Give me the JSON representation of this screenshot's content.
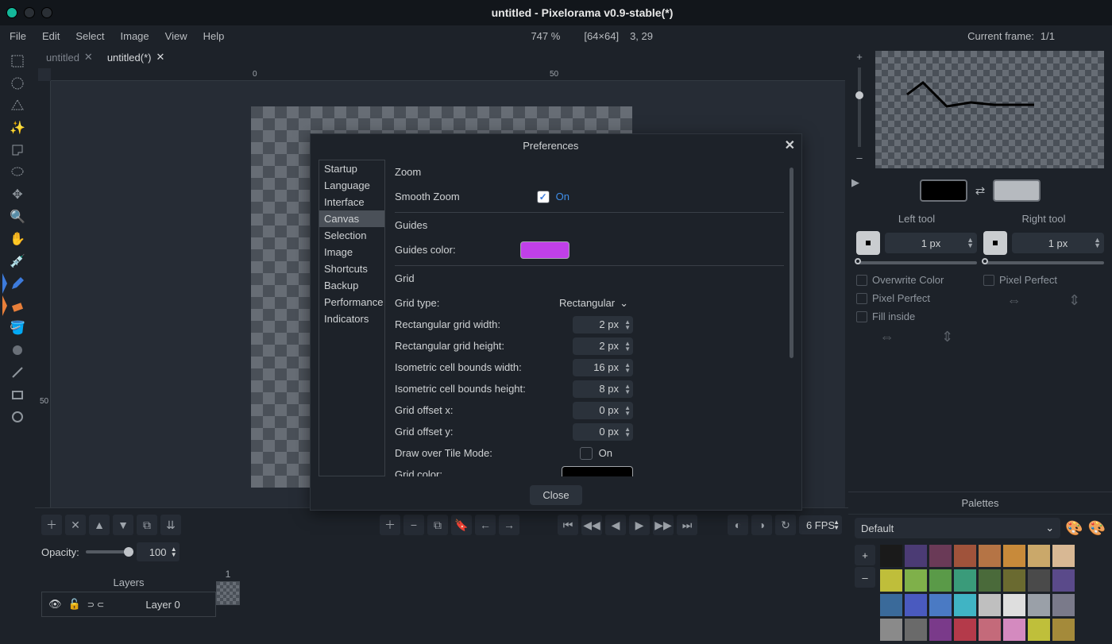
{
  "window": {
    "title": "untitled - Pixelorama v0.9-stable(*)"
  },
  "menu": {
    "items": [
      "File",
      "Edit",
      "Select",
      "Image",
      "View",
      "Help"
    ],
    "zoom": "747 %",
    "dims": "[64×64]",
    "cursor": "3, 29",
    "current_frame_lbl": "Current frame:",
    "current_frame_val": "1/1"
  },
  "tabs": [
    {
      "label": "untitled",
      "active": false
    },
    {
      "label": "untitled(*)",
      "active": true
    }
  ],
  "ruler": {
    "h0": "0",
    "h50": "50",
    "v50": "50"
  },
  "preview": {
    "plus": "+",
    "minus": "–"
  },
  "tools": {
    "left_title": "Left tool",
    "right_title": "Right tool",
    "left_px": "1 px",
    "right_px": "1 px",
    "overwrite": "Overwrite Color",
    "pixel_perfect": "Pixel Perfect",
    "fill_inside": "Fill inside"
  },
  "palettes": {
    "title": "Palettes",
    "default": "Default",
    "plus": "+",
    "minus": "–",
    "colors": [
      "#1a1a1a",
      "#4b3b74",
      "#6a3a57",
      "#a0533b",
      "#b57445",
      "#c88a3a",
      "#caa86a",
      "#d8b894",
      "#bfbe3a",
      "#7fb04a",
      "#5a9a48",
      "#3a9b7a",
      "#4a6a3a",
      "#6a6a30",
      "#4a4a4a",
      "#5a4a8a",
      "#3a6a9a",
      "#4a5abf",
      "#4a7ac4",
      "#40b4c4",
      "#bfbfbf",
      "#dedede",
      "#9aa0a8",
      "#7a7a8a",
      "#8a8a8a",
      "#6a6a6a",
      "#7a3a8a",
      "#b43a4a",
      "#c46a7a",
      "#d48abf",
      "#bfbf3a",
      "#a48a3a"
    ]
  },
  "timeline": {
    "opacity_lbl": "Opacity:",
    "opacity_val": "100",
    "fps": "6 FPS",
    "layers_lbl": "Layers",
    "layer0": "Layer 0",
    "frame_1": "1"
  },
  "dialog": {
    "title": "Preferences",
    "nav": [
      "Startup",
      "Language",
      "Interface",
      "Canvas",
      "Selection",
      "Image",
      "Shortcuts",
      "Backup",
      "Performance",
      "Indicators"
    ],
    "nav_selected": 3,
    "sec_zoom": "Zoom",
    "smooth_zoom_lbl": "Smooth Zoom",
    "smooth_zoom_on": "On",
    "sec_guides": "Guides",
    "guides_color_lbl": "Guides color:",
    "guides_color": "#c040e8",
    "sec_grid": "Grid",
    "grid_type_lbl": "Grid type:",
    "grid_type_val": "Rectangular",
    "rect_w_lbl": "Rectangular grid width:",
    "rect_w_val": "2 px",
    "rect_h_lbl": "Rectangular grid height:",
    "rect_h_val": "2 px",
    "iso_w_lbl": "Isometric cell bounds width:",
    "iso_w_val": "16 px",
    "iso_h_lbl": "Isometric cell bounds height:",
    "iso_h_val": "8 px",
    "off_x_lbl": "Grid offset x:",
    "off_x_val": "0 px",
    "off_y_lbl": "Grid offset y:",
    "off_y_val": "0 px",
    "draw_tile_lbl": "Draw over Tile Mode:",
    "draw_tile_on": "On",
    "grid_color_lbl": "Grid color:",
    "grid_color": "#000000",
    "close": "Close"
  }
}
